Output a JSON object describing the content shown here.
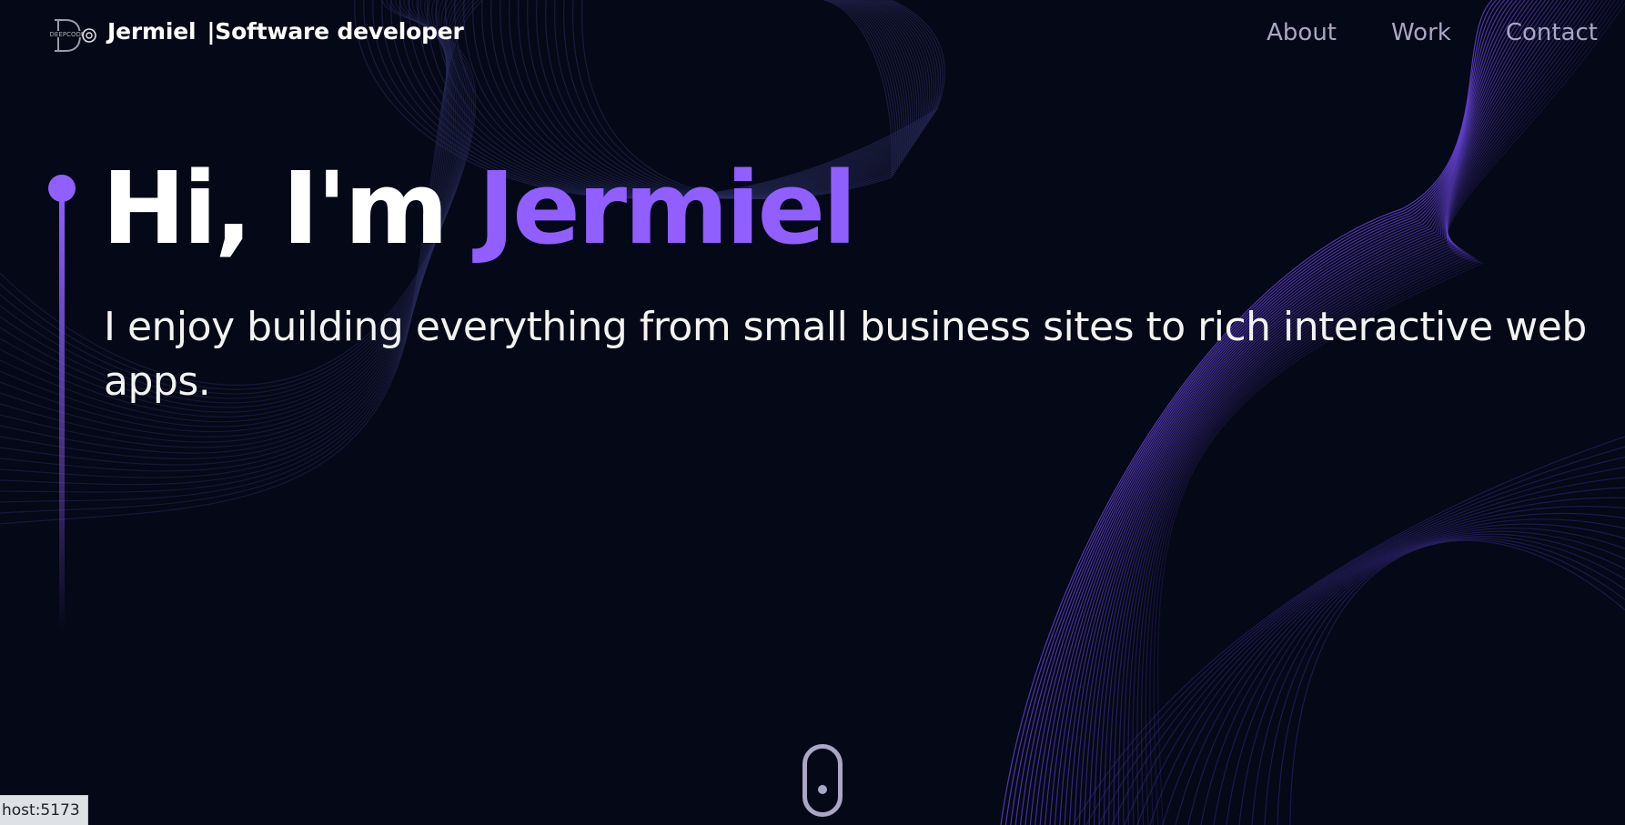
{
  "navbar": {
    "brand_name": "Jermiel",
    "brand_separator": "|",
    "brand_role": "Software developer",
    "logo_icon": "deepcode-logo-icon",
    "links": [
      "About",
      "Work",
      "Contact"
    ]
  },
  "hero": {
    "greeting": "Hi, I'm ",
    "name": "Jermiel",
    "subtitle": "I enjoy building everything from small business sites to rich interactive web apps."
  },
  "scroll_indicator": {
    "icon": "mouse-scroll-icon"
  },
  "status_bar": {
    "url": "host:5173"
  },
  "colors": {
    "background": "#050816",
    "accent": "#915eff",
    "nav_text": "#aaa6c3",
    "heading": "#ffffff"
  }
}
